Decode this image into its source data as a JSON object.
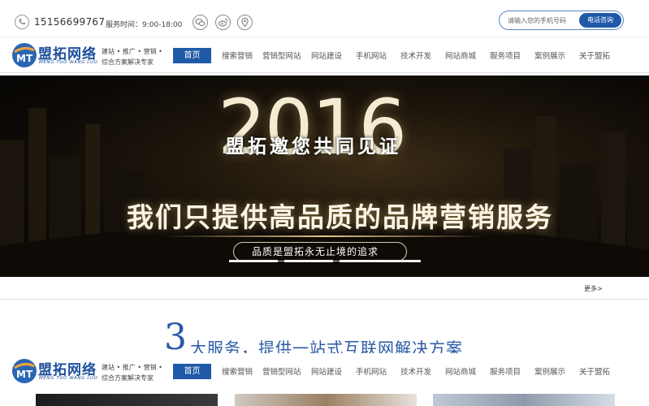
{
  "topbar": {
    "phone": "15156699767",
    "service_time": "服务时间：9:00-18:00",
    "social_icons": [
      "wechat-icon",
      "weibo-icon",
      "location-icon"
    ],
    "search_placeholder": "请输入您的手机号码",
    "call_button": "电话咨询"
  },
  "logo": {
    "name": "盟拓网络",
    "pinyin": "MENG TUO WANG LUO",
    "slogan1": "建站 • 推广 • 营销 •",
    "slogan2": "综合方案解决专家"
  },
  "nav": {
    "items": [
      "首页",
      "搜索营销",
      "营销型网站",
      "网站建设",
      "手机网站",
      "技术开发",
      "网站商城",
      "服务项目",
      "案例展示",
      "关于盟拓"
    ],
    "active_index": 0
  },
  "banner": {
    "year": "2016",
    "invite": "盟拓邀您共同见证",
    "headline": "我们只提供高品质的品牌营销服务",
    "pill_text": "品质是盟拓永无止境的追求",
    "slides": 4,
    "active_slide": 0
  },
  "more_link": "更多>",
  "services": {
    "big_number": "3",
    "title": "大服务，提供一站式互联网解决方案"
  },
  "colors": {
    "brand_blue": "#1f5aa8",
    "accent_gold": "#f4ecd2"
  }
}
